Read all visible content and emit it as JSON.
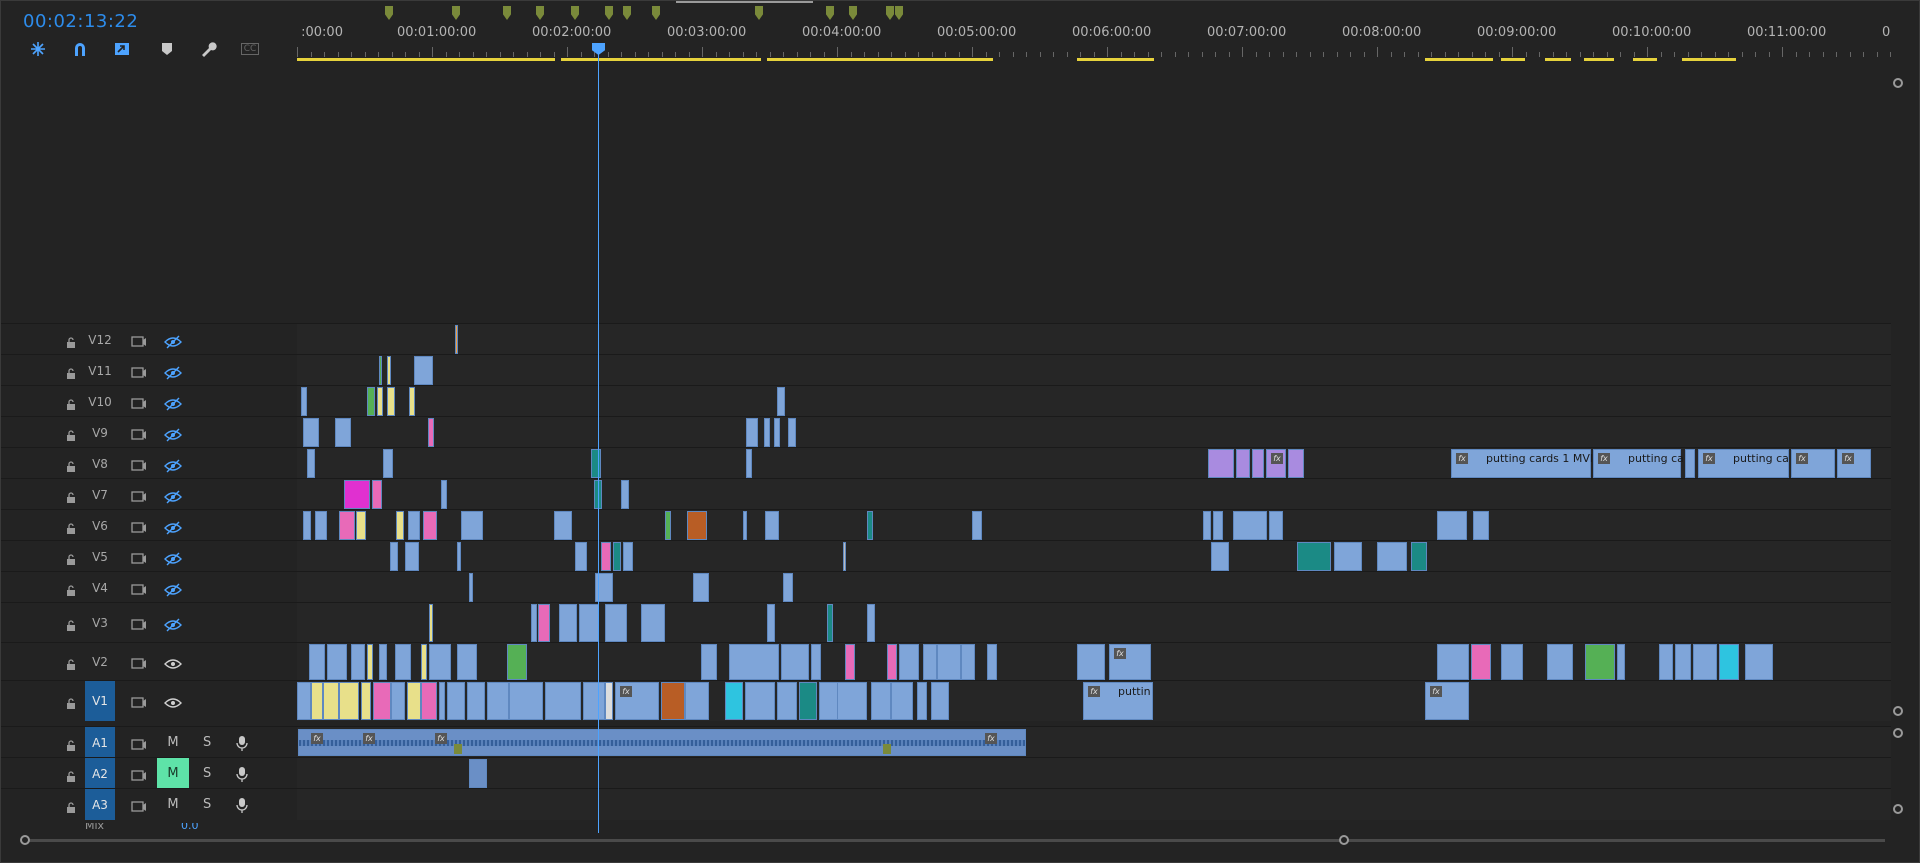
{
  "timecode": "00:02:13:22",
  "toolbar": {
    "icons": [
      "snap-icon",
      "magnet-icon",
      "linked-selection-icon",
      "add-marker-icon",
      "wrench-icon",
      "captions-icon"
    ],
    "captions_label": "CC"
  },
  "ruler": {
    "labels": [
      " :00:00",
      "00:01:00:00",
      "00:02:00:00",
      "00:03:00:00",
      "00:04:00:00",
      "00:05:00:00",
      "00:06:00:00",
      "00:07:00:00",
      "00:08:00:00",
      "00:09:00:00",
      "00:10:00:00",
      "00:11:00:00",
      "0"
    ]
  },
  "video_tracks": [
    {
      "name": "V12"
    },
    {
      "name": "V11"
    },
    {
      "name": "V10"
    },
    {
      "name": "V9"
    },
    {
      "name": "V8"
    },
    {
      "name": "V7"
    },
    {
      "name": "V6"
    },
    {
      "name": "V5"
    },
    {
      "name": "V4"
    },
    {
      "name": "V3"
    },
    {
      "name": "V2"
    },
    {
      "name": "V1"
    }
  ],
  "audio_tracks": [
    {
      "name": "A1",
      "mute": "M",
      "solo": "S"
    },
    {
      "name": "A2",
      "mute": "M",
      "solo": "S"
    },
    {
      "name": "A3",
      "mute": "M",
      "solo": "S"
    }
  ],
  "mix_label": "Mix",
  "mix_value": "0.0",
  "clip_labels": {
    "v8_a": "putting cards 1 MVI",
    "v8_b": "putting ca",
    "v8_c": "putting ca",
    "v1_a": "puttin"
  },
  "colors": {
    "accent": "#2d8ceb",
    "clip_blue": "#7fa5d9",
    "clip_purple": "#a98be0",
    "clip_pink": "#e86ab8",
    "clip_green": "#55b055",
    "clip_teal": "#1b8a85",
    "clip_orange": "#b85d25",
    "clip_yellow": "#e8e08a",
    "clip_cyan": "#2ec4e0",
    "mute_on": "#5ee3a8"
  }
}
